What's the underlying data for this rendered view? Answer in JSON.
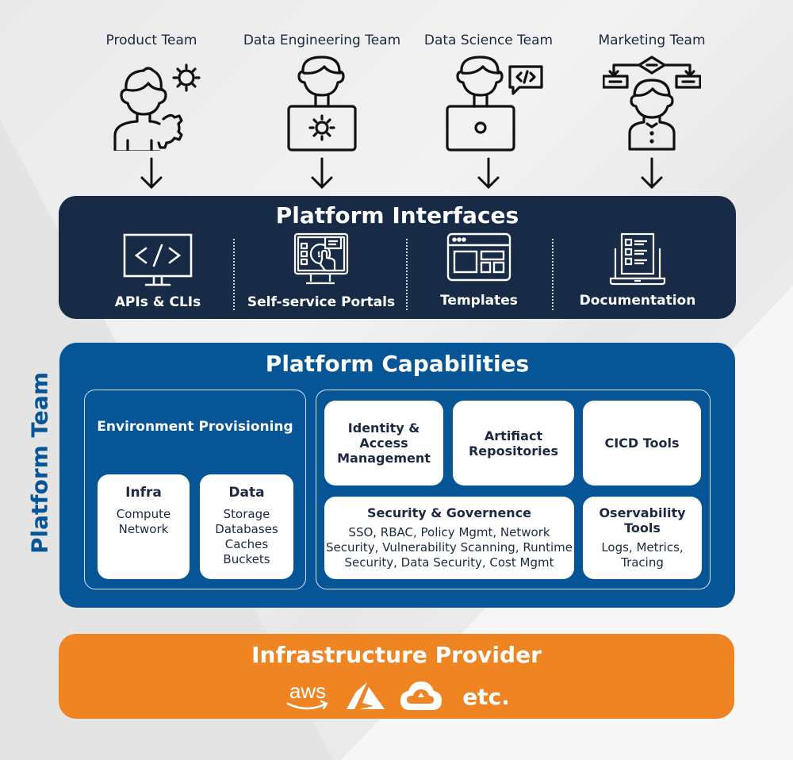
{
  "teams": [
    {
      "label": "Product Team",
      "icon": "person-gears-icon"
    },
    {
      "label": "Data Engineering Team",
      "icon": "person-laptop-gear-icon"
    },
    {
      "label": "Data Science Team",
      "icon": "person-laptop-code-icon"
    },
    {
      "label": "Marketing Team",
      "icon": "person-flowchart-icon"
    }
  ],
  "interfaces": {
    "title": "Platform Interfaces",
    "items": [
      {
        "label": "APIs & CLIs",
        "icon": "monitor-code-icon"
      },
      {
        "label": "Self-service Portals",
        "icon": "touch-screen-portal-icon"
      },
      {
        "label": "Templates",
        "icon": "browser-template-icon"
      },
      {
        "label": "Documentation",
        "icon": "laptop-checklist-icon"
      }
    ]
  },
  "capabilities": {
    "title": "Platform Capabilities",
    "side_label": "Platform Team",
    "environment": {
      "title": "Environment Provisioning",
      "infra": {
        "title": "Infra",
        "items": [
          "Compute",
          "Network"
        ]
      },
      "data": {
        "title": "Data",
        "items": [
          "Storage",
          "Databases",
          "Caches",
          "Buckets"
        ]
      }
    },
    "services": {
      "iam": {
        "title_lines": [
          "Identity &",
          "Access",
          "Management"
        ]
      },
      "artifacts": {
        "title_lines": [
          "Artifiact",
          "Repositories"
        ]
      },
      "cicd": {
        "title": "CICD Tools"
      },
      "security": {
        "title": "Security & Governence",
        "body_lines": [
          "SSO, RBAC, Policy Mgmt, Network",
          "Security, Vulnerability Scanning, Runtime",
          "Security, Data Security, Cost Mgmt"
        ]
      },
      "observability": {
        "title_lines": [
          "Oservability",
          "Tools"
        ],
        "body_lines": [
          "Logs, Metrics,",
          "Tracing"
        ]
      }
    }
  },
  "provider": {
    "title": "Infrastructure Provider",
    "logos": [
      {
        "name": "aws-logo",
        "text": "aws"
      },
      {
        "name": "azure-logo"
      },
      {
        "name": "google-cloud-logo"
      }
    ],
    "etc": "etc."
  },
  "colors": {
    "interfaces_bg": "#172a46",
    "capabilities_bg": "#065596",
    "provider_bg": "#ef8423",
    "text_dark": "#1c2940"
  }
}
